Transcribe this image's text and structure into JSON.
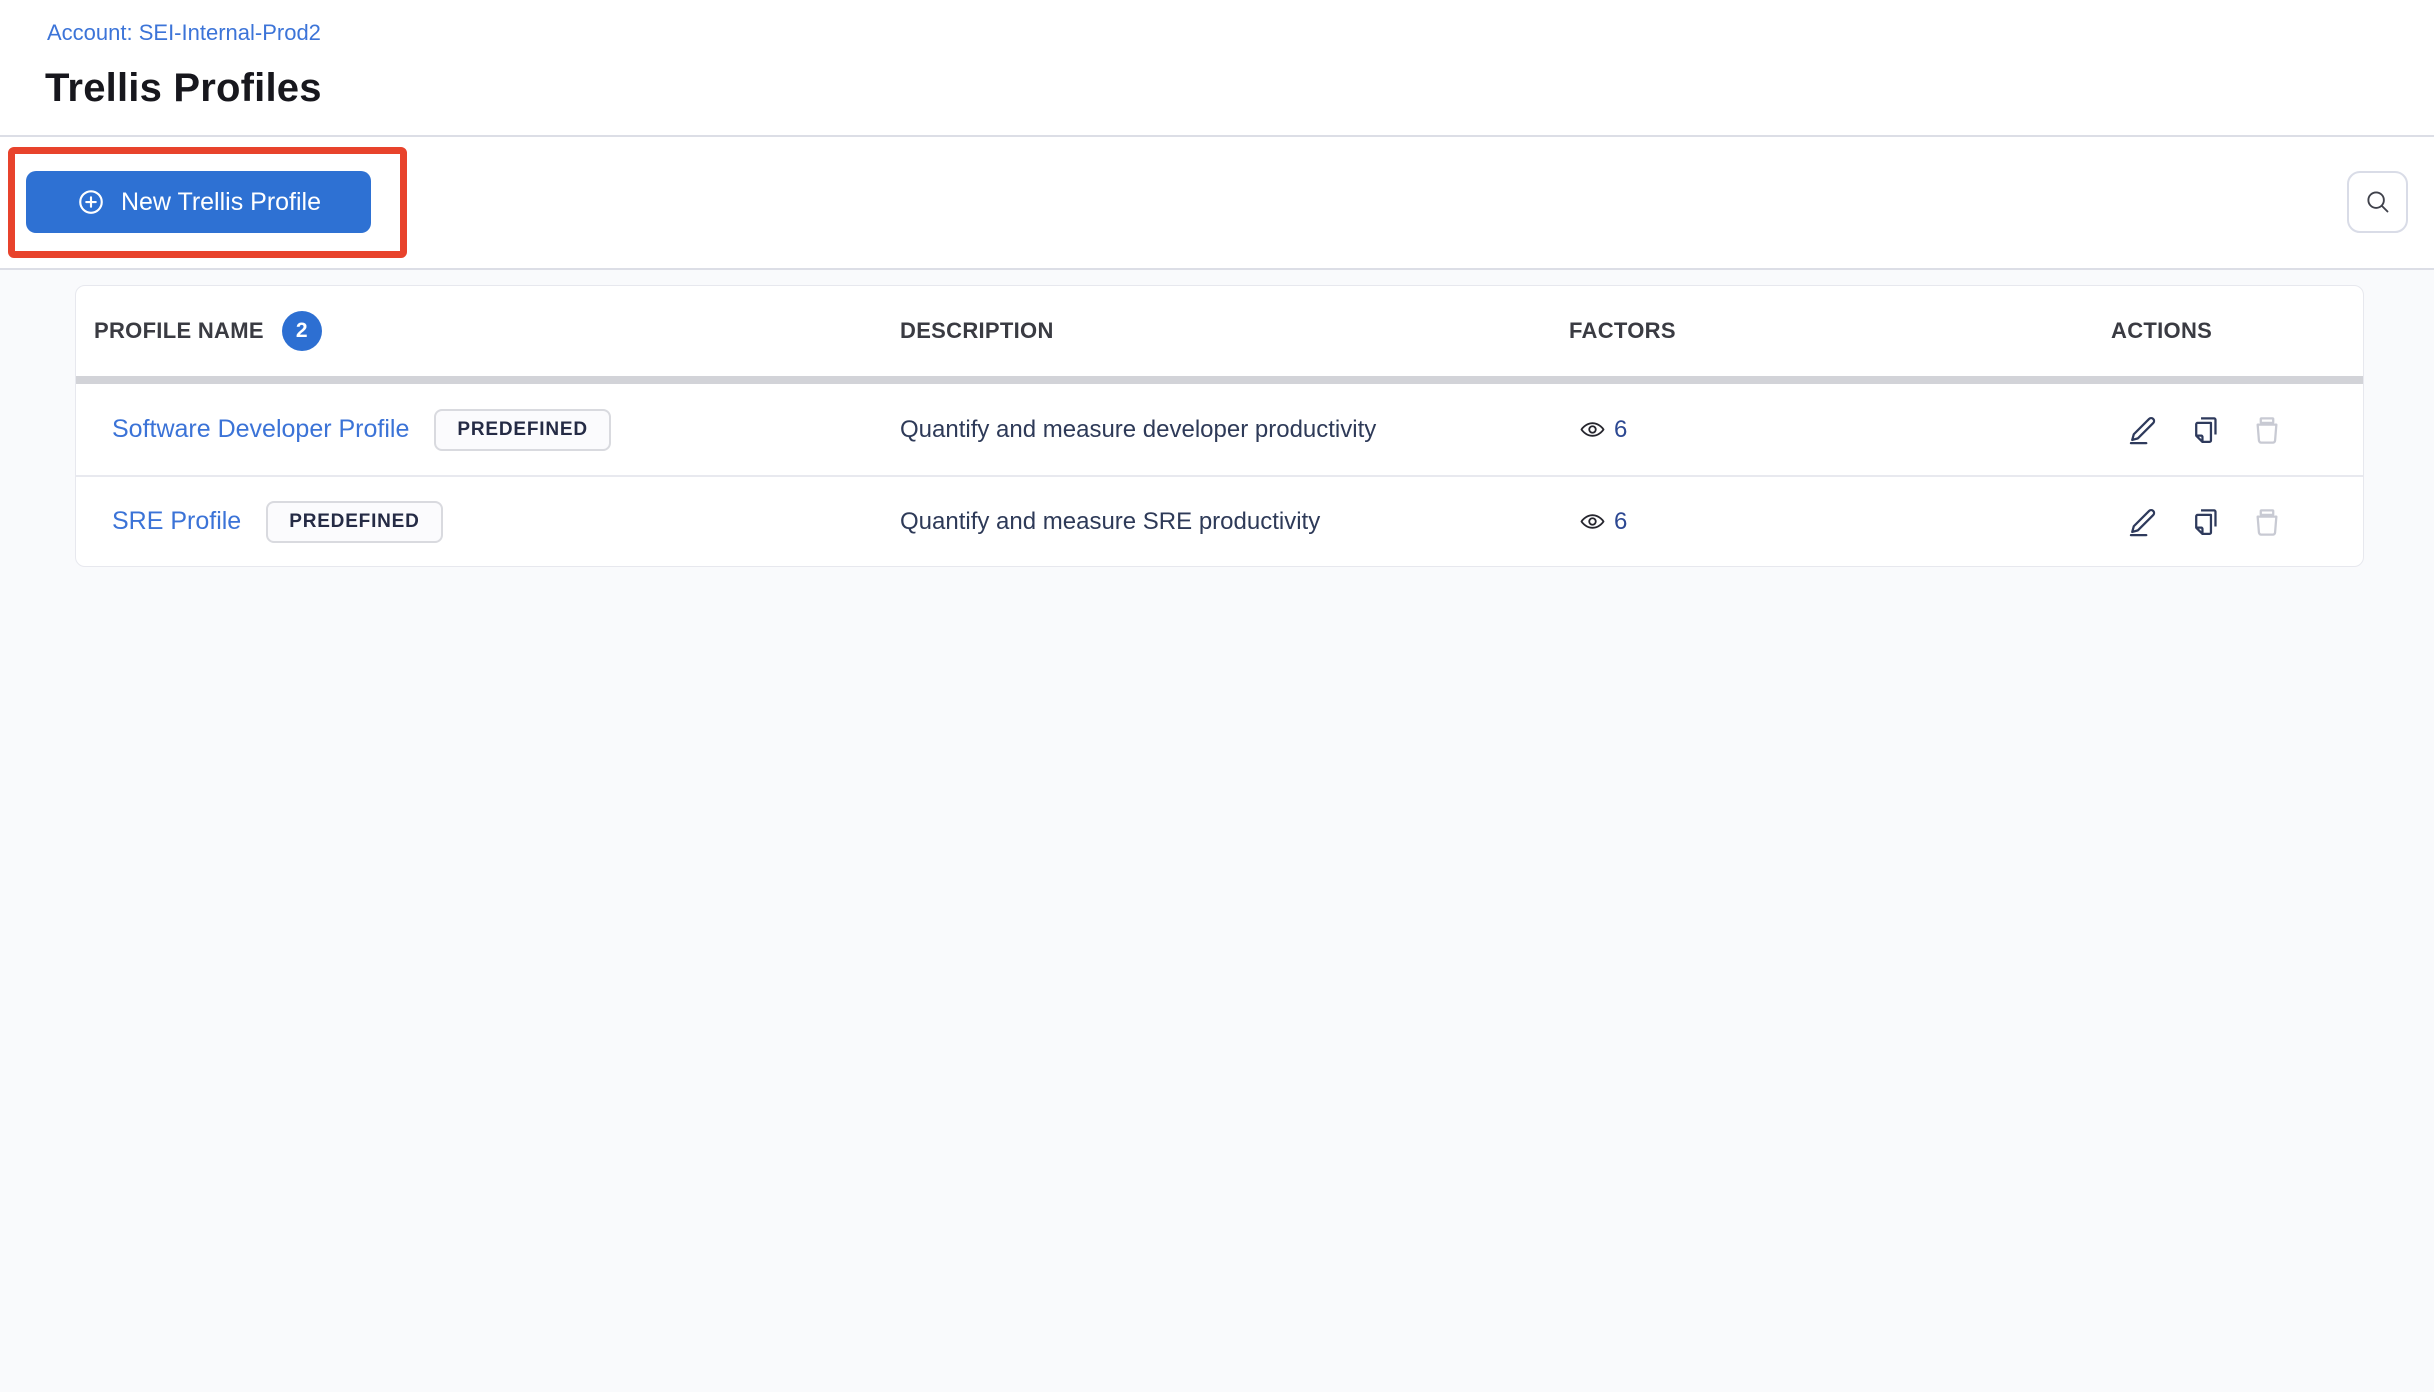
{
  "page": {
    "account_breadcrumb": "Account: SEI-Internal-Prod2",
    "title": "Trellis Profiles"
  },
  "toolbar": {
    "new_profile_button_label": "New Trellis Profile"
  },
  "table": {
    "headers": {
      "profile_name": "PROFILE NAME",
      "description": "DESCRIPTION",
      "factors": "FACTORS",
      "actions": "ACTIONS"
    },
    "profile_count_badge": "2",
    "rows": [
      {
        "name": "Software Developer Profile",
        "tag": "PREDEFINED",
        "description": "Quantify and measure developer productivity",
        "factors_count": "6"
      },
      {
        "name": "SRE Profile",
        "tag": "PREDEFINED",
        "description": "Quantify and measure SRE productivity",
        "factors_count": "6"
      }
    ]
  },
  "icons": {
    "button_icon": "plus-circle-icon",
    "search_icon": "magnifier-icon",
    "factors_icon": "eye-icon",
    "row_actions": [
      "edit-pencil-icon",
      "copy-icon",
      "trash-icon"
    ]
  },
  "colors": {
    "primary_button_blue": "#2e71d3",
    "link_blue": "#3b73d7",
    "count_badge_blue": "#2d6fd2",
    "annotation_red": "#e8432c",
    "action_icon_navy": "#2e3a5c",
    "disabled_icon_gray": "#c8cad3",
    "header_text": "#3a3b42",
    "description_text": "#2e3a58",
    "body_background": "#f9fafc"
  }
}
